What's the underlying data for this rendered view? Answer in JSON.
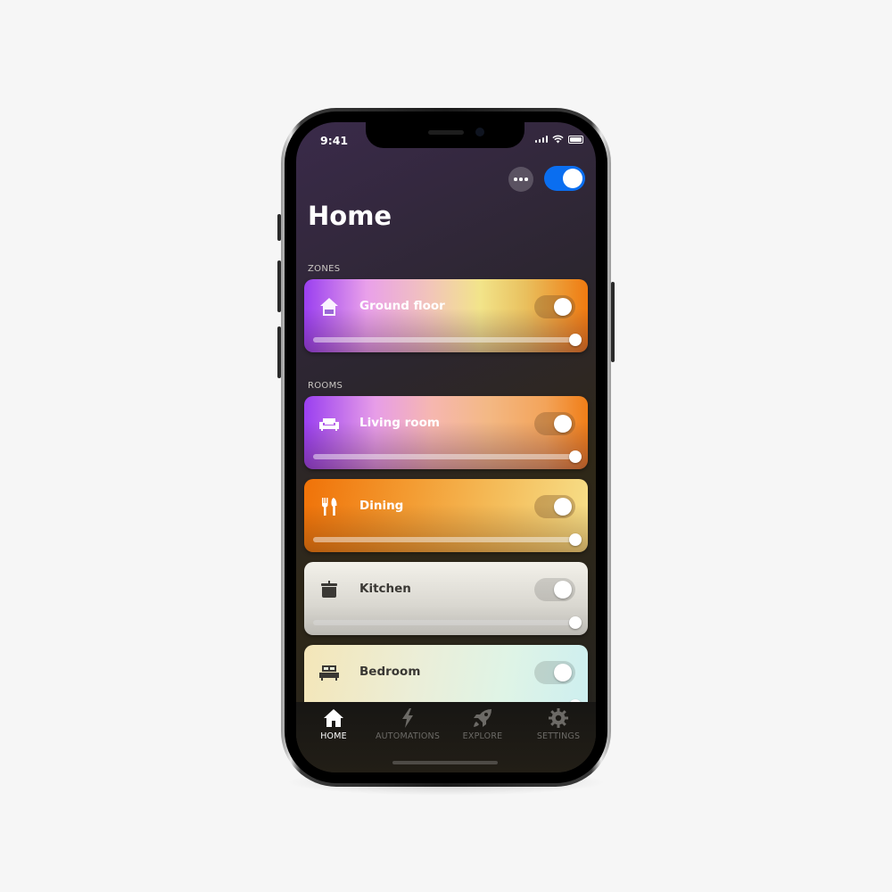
{
  "status_bar": {
    "time": "9:41",
    "icons": [
      "cellular-signal-icon",
      "wifi-icon",
      "battery-icon"
    ]
  },
  "header": {
    "more_icon": "ellipsis-icon",
    "master_toggle_on": true,
    "title": "Home"
  },
  "zones": {
    "label": "ZONES",
    "items": [
      {
        "name": "Ground floor",
        "icon": "house-icon",
        "on": true,
        "brightness": 100
      }
    ]
  },
  "rooms": {
    "label": "ROOMS",
    "items": [
      {
        "name": "Living room",
        "icon": "sofa-icon",
        "on": true,
        "brightness": 100
      },
      {
        "name": "Dining",
        "icon": "fork-knife-icon",
        "on": true,
        "brightness": 100
      },
      {
        "name": "Kitchen",
        "icon": "cooking-pot-icon",
        "on": true,
        "brightness": 100
      },
      {
        "name": "Bedroom",
        "icon": "bed-icon",
        "on": true,
        "brightness": 100
      }
    ]
  },
  "tabbar": {
    "tabs": [
      {
        "label": "HOME",
        "icon": "home-icon",
        "active": true
      },
      {
        "label": "AUTOMATIONS",
        "icon": "lightning-bolt-icon",
        "active": false
      },
      {
        "label": "EXPLORE",
        "icon": "rocket-icon",
        "active": false
      },
      {
        "label": "SETTINGS",
        "icon": "gear-icon",
        "active": false
      }
    ]
  },
  "colors": {
    "accent": "#0a6ef0",
    "active_tab": "#ffffff",
    "inactive_tab": "#6c6a66"
  }
}
